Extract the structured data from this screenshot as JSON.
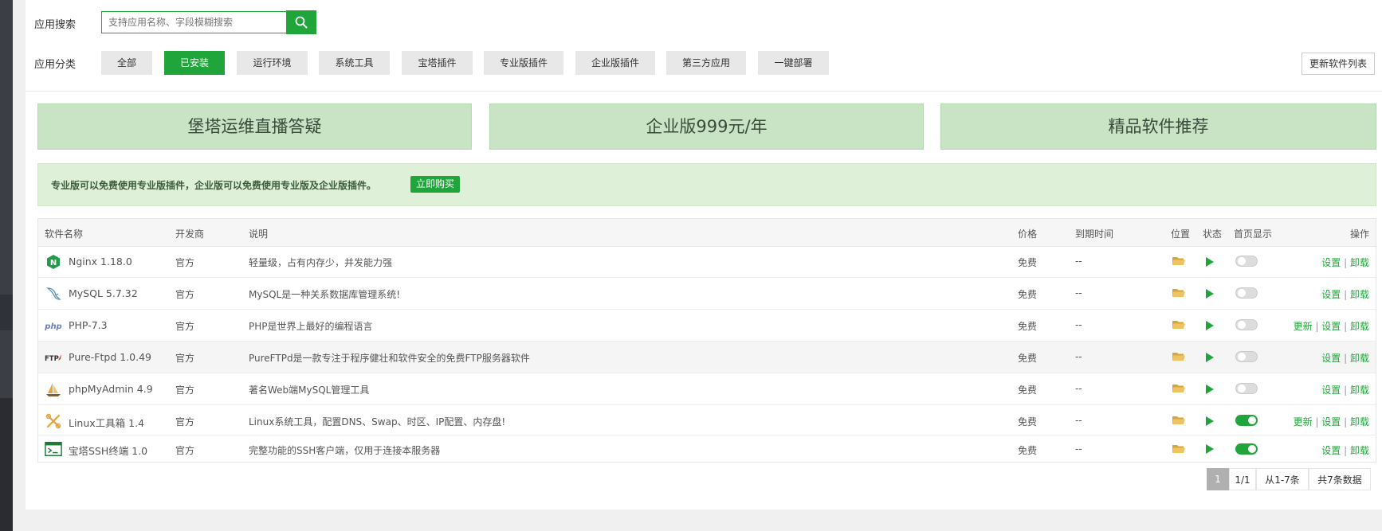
{
  "search": {
    "label": "应用搜索",
    "placeholder": "支持应用名称、字段模糊搜索",
    "icon": "search-icon"
  },
  "categories": {
    "label": "应用分类",
    "items": [
      "全部",
      "已安装",
      "运行环境",
      "系统工具",
      "宝塔插件",
      "专业版插件",
      "企业版插件",
      "第三方应用",
      "一键部署"
    ],
    "active": "已安装"
  },
  "update_list_label": "更新软件列表",
  "banners": [
    "堡塔运维直播答疑",
    "企业版999元/年",
    "精品软件推荐"
  ],
  "notice": {
    "text": "专业版可以免费使用专业版插件，企业版可以免费使用专业版及企业版插件。",
    "button": "立即购买"
  },
  "table": {
    "headers": {
      "name": "软件名称",
      "developer": "开发商",
      "description": "说明",
      "price": "价格",
      "expiry": "到期时间",
      "location": "位置",
      "status": "状态",
      "homepage": "首页显示",
      "actions": "操作"
    },
    "rows": [
      {
        "icon": "nginx-icon",
        "name": "Nginx 1.18.0",
        "developer": "官方",
        "description": "轻量级，占有内存少，并发能力强",
        "price": "免费",
        "expiry": "--",
        "homepage_on": false,
        "actions": [
          "设置",
          "卸载"
        ]
      },
      {
        "icon": "mysql-dolphin-icon",
        "name": "MySQL 5.7.32",
        "developer": "官方",
        "description": "MySQL是一种关系数据库管理系统!",
        "price": "免费",
        "expiry": "--",
        "homepage_on": false,
        "actions": [
          "设置",
          "卸载"
        ]
      },
      {
        "icon": "php-icon",
        "name": "PHP-7.3",
        "developer": "官方",
        "description": "PHP是世界上最好的编程语言",
        "price": "免费",
        "expiry": "--",
        "homepage_on": false,
        "actions": [
          "更新",
          "设置",
          "卸载"
        ]
      },
      {
        "icon": "ftp-icon",
        "name": "Pure-Ftpd 1.0.49",
        "developer": "官方",
        "description": "PureFTPd是一款专注于程序健壮和软件安全的免费FTP服务器软件",
        "price": "免费",
        "expiry": "--",
        "homepage_on": false,
        "actions": [
          "设置",
          "卸载"
        ]
      },
      {
        "icon": "phpmyadmin-sailboat-icon",
        "name": "phpMyAdmin 4.9",
        "developer": "官方",
        "description": "著名Web端MySQL管理工具",
        "price": "免费",
        "expiry": "--",
        "homepage_on": false,
        "actions": [
          "设置",
          "卸载"
        ]
      },
      {
        "icon": "linux-tools-icon",
        "name": "Linux工具箱 1.4",
        "developer": "官方",
        "description": "Linux系统工具，配置DNS、Swap、时区、IP配置、内存盘!",
        "price": "免费",
        "expiry": "--",
        "homepage_on": true,
        "actions": [
          "更新",
          "设置",
          "卸载"
        ]
      },
      {
        "icon": "terminal-icon",
        "name": "宝塔SSH终端 1.0",
        "developer": "官方",
        "description": "完整功能的SSH客户端，仅用于连接本服务器",
        "price": "免费",
        "expiry": "--",
        "homepage_on": true,
        "actions": [
          "设置",
          "卸载"
        ]
      }
    ]
  },
  "pagination": {
    "current": "1",
    "pages": "1/1",
    "range": "从1-7条",
    "total": "共7条数据"
  },
  "colors": {
    "accent": "#20a53a",
    "banner_bg": "#c8e4c5",
    "notice_bg": "#dff0d8",
    "folder": "#e9b64f"
  }
}
